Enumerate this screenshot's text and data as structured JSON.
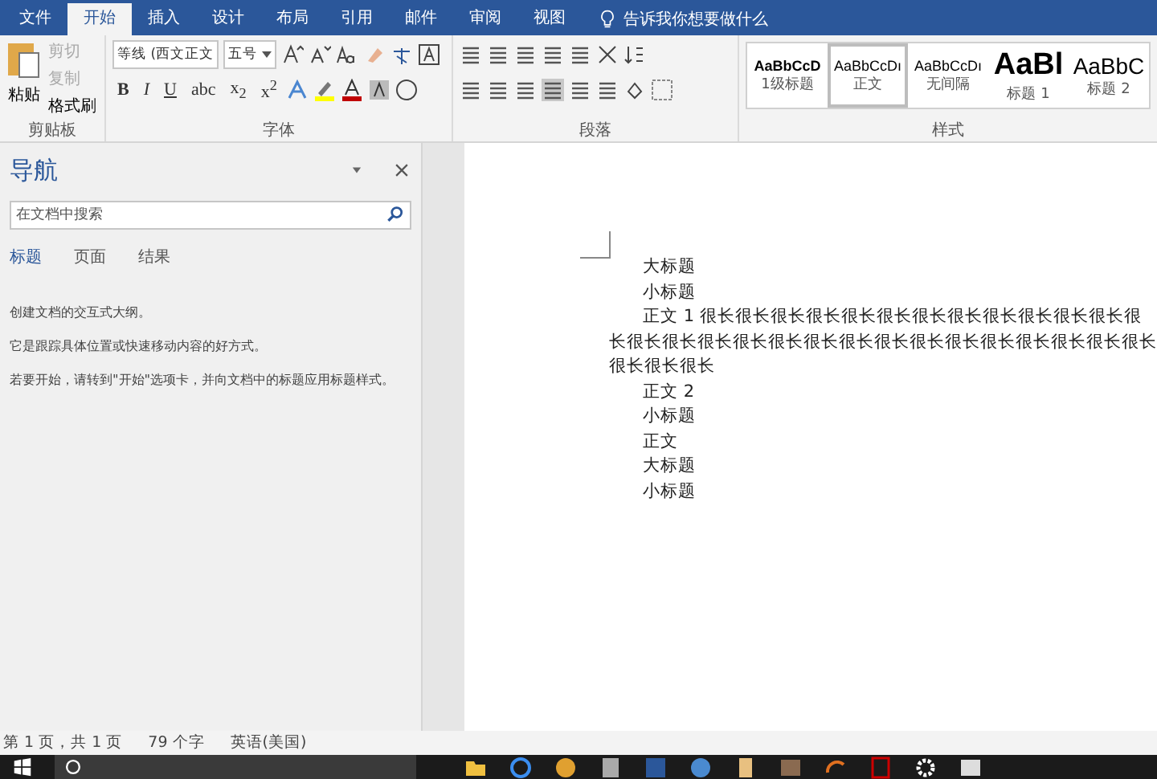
{
  "tabs": [
    {
      "label": "文件",
      "selected": false
    },
    {
      "label": "开始",
      "selected": true
    },
    {
      "label": "插入",
      "selected": false
    },
    {
      "label": "设计",
      "selected": false
    },
    {
      "label": "布局",
      "selected": false
    },
    {
      "label": "引用",
      "selected": false
    },
    {
      "label": "邮件",
      "selected": false
    },
    {
      "label": "审阅",
      "selected": false
    },
    {
      "label": "视图",
      "selected": false
    }
  ],
  "tell_me": "告诉我你想要做什么",
  "clipboard": {
    "paste": "粘贴",
    "items": [
      {
        "label": "剪切",
        "disabled": true
      },
      {
        "label": "复制",
        "disabled": true
      },
      {
        "label": "格式刷",
        "disabled": false
      }
    ],
    "group_label": "剪贴板"
  },
  "font": {
    "font_name": "等线 (西文正文",
    "font_size": "五号",
    "format_buttons": [
      "B",
      "I",
      "U",
      "abc",
      "x$_{2}$",
      "x$^{2}$"
    ],
    "group_label": "字体"
  },
  "paragraph": {
    "group_label": "段落"
  },
  "styles": {
    "items": [
      {
        "preview": "AaBbCcD",
        "name": "1级标题",
        "selected": false,
        "kind": "bold"
      },
      {
        "preview": "AaBbCcDı",
        "name": "正文",
        "selected": true,
        "kind": "normal"
      },
      {
        "preview": "AaBbCcDı",
        "name": "无间隔",
        "selected": false,
        "kind": "normal"
      },
      {
        "preview": "AaBl",
        "name": "标题 1",
        "selected": false,
        "kind": "big"
      },
      {
        "preview": "AaBbC",
        "name": "标题 2",
        "selected": false,
        "kind": "medium"
      }
    ],
    "group_label": "样式"
  },
  "navigation": {
    "title": "导航",
    "search_placeholder": "在文档中搜索",
    "tabs": [
      {
        "label": "标题",
        "selected": true
      },
      {
        "label": "页面",
        "selected": false
      },
      {
        "label": "结果",
        "selected": false
      }
    ],
    "messages": [
      "创建文档的交互式大纲。",
      "它是跟踪具体位置或快速移动内容的好方式。",
      "若要开始，请转到\"开始\"选项卡，并向文档中的标题应用标题样式。"
    ]
  },
  "document": {
    "paragraphs": [
      "大标题",
      "小标题",
      "正文 1 很长很长很长很长很长很长很长很长很长很长很长很长很长很长很长很长很长很长很长很长很长很长很长很长很长很长很长很长很长很长很长",
      "正文 2",
      "小标题",
      "正文",
      "大标题",
      "小标题"
    ]
  },
  "status_bar": {
    "page": "第 1 页，共 1 页",
    "words": "79 个字",
    "language": "英语(美国)"
  }
}
